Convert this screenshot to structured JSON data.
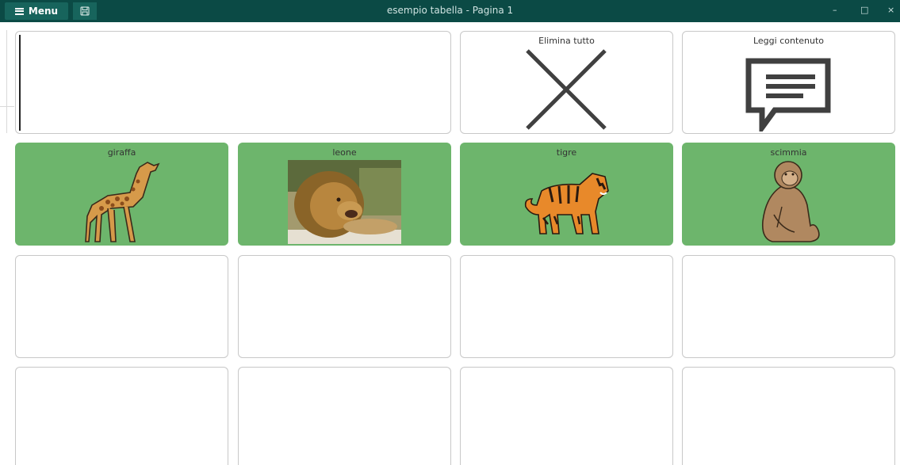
{
  "window": {
    "title": "esempio tabella - Pagina 1",
    "menu_label": "Menu",
    "minimize_glyph": "–",
    "maximize_glyph": "□",
    "close_glyph": "×"
  },
  "actions": {
    "delete_all": {
      "label": "Elimina tutto",
      "icon": "x-icon"
    },
    "read_content": {
      "label": "Leggi contenuto",
      "icon": "speech-bubble-icon"
    }
  },
  "animals": [
    {
      "label": "giraffa",
      "icon": "giraffe-icon"
    },
    {
      "label": "leone",
      "icon": "lion-photo"
    },
    {
      "label": "tigre",
      "icon": "tiger-icon"
    },
    {
      "label": "scimmia",
      "icon": "monkey-icon"
    }
  ],
  "colors": {
    "titlebar": "#0b4a45",
    "button": "#17645c",
    "cell_green": "#6db56c"
  }
}
